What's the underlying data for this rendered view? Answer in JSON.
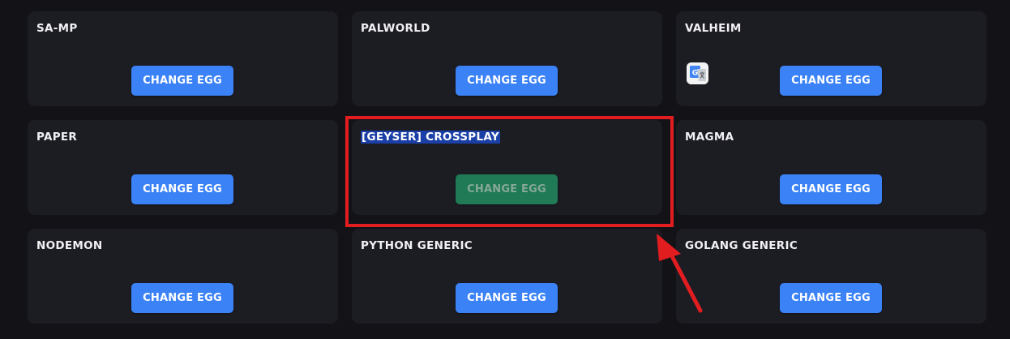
{
  "cards": [
    {
      "title": "SA-MP",
      "button_label": "CHANGE EGG"
    },
    {
      "title": "PALWORLD",
      "button_label": "CHANGE EGG"
    },
    {
      "title": "VALHEIM",
      "button_label": "CHANGE EGG"
    },
    {
      "title": "PAPER",
      "button_label": "CHANGE EGG"
    },
    {
      "title": "[GEYSER] CROSSPLAY",
      "button_label": "CHANGE EGG"
    },
    {
      "title": "MAGMA",
      "button_label": "CHANGE EGG"
    },
    {
      "title": "NODEMON",
      "button_label": "CHANGE EGG"
    },
    {
      "title": "PYTHON GENERIC",
      "button_label": "CHANGE EGG"
    },
    {
      "title": "GOLANG GENERIC",
      "button_label": "CHANGE EGG"
    }
  ],
  "colors": {
    "background": "#121217",
    "card": "#1c1c23",
    "button": "#3b82f6",
    "button_active": "#1f7a55",
    "selection": "#1a3fa6",
    "annotation": "#e11d20"
  },
  "icons": {
    "valheim_overlay": "google-translate-icon",
    "annotation": "red-arrow-icon"
  }
}
